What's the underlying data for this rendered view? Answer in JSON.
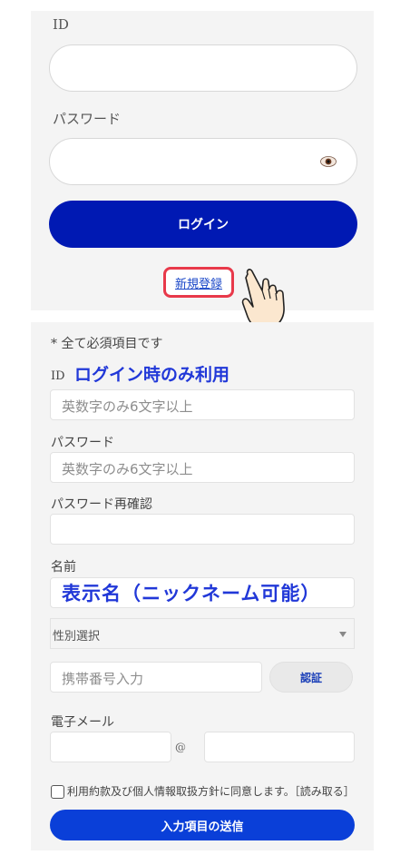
{
  "login": {
    "id_label": "ID",
    "password_label": "パスワード",
    "login_button": "ログイン",
    "register_link": "新規登録"
  },
  "register": {
    "required_note": "* 全て必須項目です",
    "id_label": "ID",
    "id_note": "ログイン時のみ利用",
    "id_placeholder": "英数字のみ6文字以上",
    "password_label": "パスワード",
    "password_placeholder": "英数字のみ6文字以上",
    "password_confirm_label": "パスワード再確認",
    "name_label": "名前",
    "name_note": "表示名（ニックネーム可能）",
    "gender_select": "性別選択",
    "phone_placeholder": "携帯番号入力",
    "auth_button": "認証",
    "email_label": "電子メール",
    "email_at": "@",
    "agree_text": "利用約款及び個人情報取扱方針に同意します。［読み取る］",
    "submit_button": "入力項目の送信"
  },
  "icons": [
    "eye-icon",
    "pointing-hand-icon",
    "chevron-down-icon"
  ],
  "colors": {
    "primary": "#0019b3",
    "submit": "#0a3fd8",
    "highlight": "#e8394a",
    "note_blue": "#2138d8",
    "panel_bg": "#f4f4f4"
  }
}
